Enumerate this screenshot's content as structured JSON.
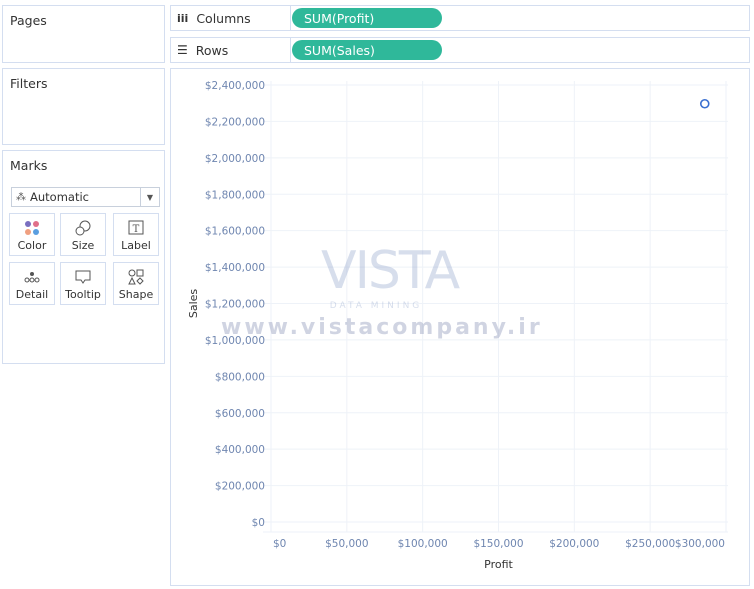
{
  "left": {
    "pages_title": "Pages",
    "filters_title": "Filters",
    "marks": {
      "title": "Marks",
      "mark_type": "Automatic",
      "buttons": [
        {
          "label": "Color",
          "icon": "color-dots-icon"
        },
        {
          "label": "Size",
          "icon": "size-circles-icon"
        },
        {
          "label": "Label",
          "icon": "label-text-icon"
        },
        {
          "label": "Detail",
          "icon": "detail-dots-icon"
        },
        {
          "label": "Tooltip",
          "icon": "tooltip-bubble-icon"
        },
        {
          "label": "Shape",
          "icon": "shape-icon"
        }
      ]
    }
  },
  "shelves": {
    "columns": {
      "label": "Columns",
      "pill": "SUM(Profit)"
    },
    "rows": {
      "label": "Rows",
      "pill": "SUM(Sales)"
    }
  },
  "watermark": {
    "logo": "VISTA",
    "subtitle": "DATA MINING",
    "url": "www.vistacompany.ir"
  },
  "colors": {
    "pill": "#2fb89a",
    "mark": "#3a6fd0",
    "tick": "#6f86b0"
  },
  "chart_data": {
    "type": "scatter",
    "xlabel": "Profit",
    "ylabel": "Sales",
    "xlim": [
      0,
      300000
    ],
    "ylim": [
      0,
      2400000
    ],
    "xticks": [
      "$0",
      "$50,000",
      "$100,000",
      "$150,000",
      "$200,000",
      "$250,000",
      "$300,000"
    ],
    "yticks": [
      "$0",
      "$200,000",
      "$400,000",
      "$600,000",
      "$800,000",
      "$1,000,000",
      "$1,200,000",
      "$1,400,000",
      "$1,600,000",
      "$1,800,000",
      "$2,000,000",
      "$2,200,000",
      "$2,400,000"
    ],
    "grid": true,
    "points": [
      {
        "x": 286000,
        "y": 2297000
      }
    ],
    "marker": "open-circle"
  }
}
